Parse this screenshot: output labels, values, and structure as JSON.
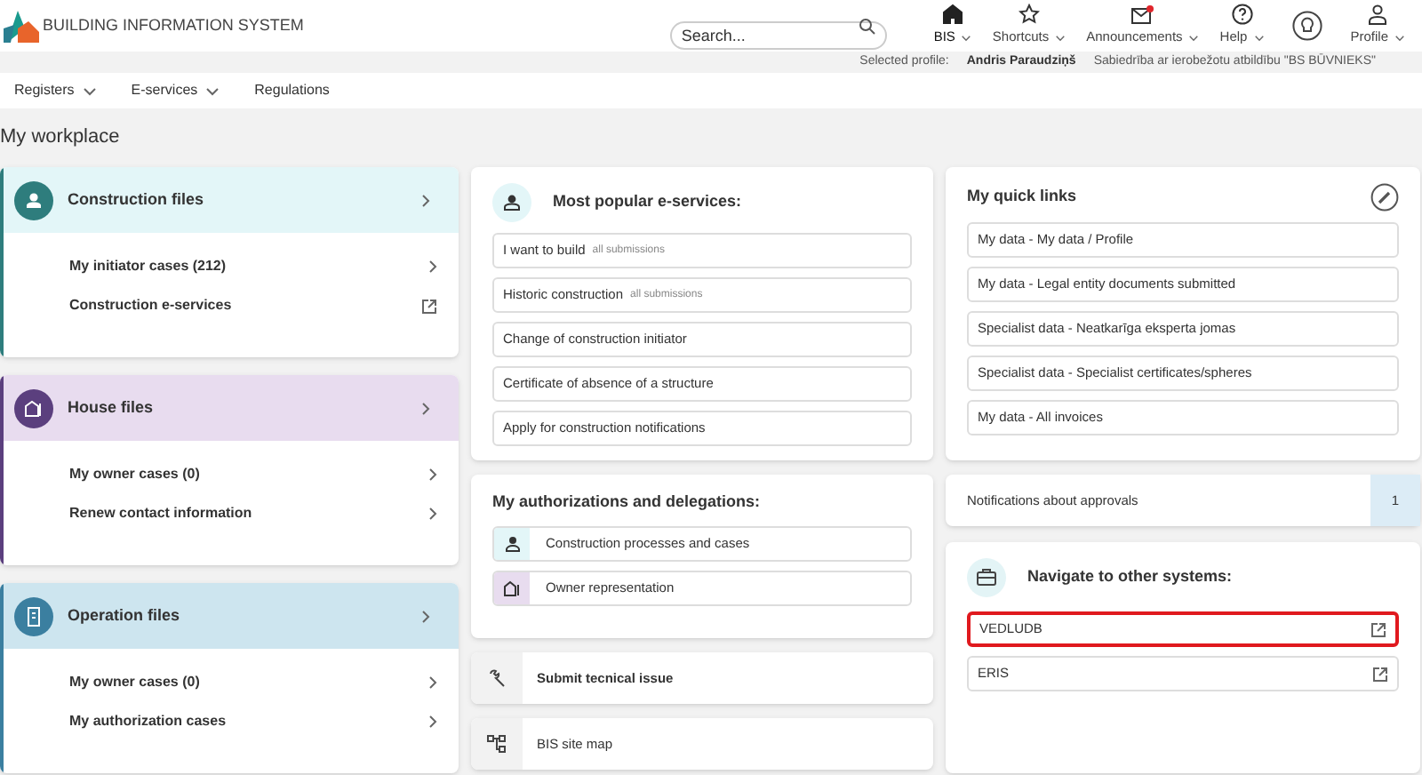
{
  "header": {
    "title": "BUILDING INFORMATION SYSTEM",
    "search": {
      "placeholder": "Search..."
    },
    "nav": [
      {
        "label": "BIS",
        "selected": true,
        "dropdown": true
      },
      {
        "label": "Shortcuts",
        "selected": false,
        "dropdown": true
      },
      {
        "label": "Announcements",
        "selected": false,
        "dropdown": true,
        "unread": true
      },
      {
        "label": "Help",
        "selected": false,
        "dropdown": true
      },
      {
        "label": "Profile",
        "selected": false,
        "dropdown": true
      }
    ]
  },
  "profile_bar": {
    "label": "Selected profile:",
    "name": "Andris Paraudziņš",
    "company": "Sabiedrība ar ierobežotu atbildību \"BS BŪVNIEKS\""
  },
  "menu": [
    {
      "label": "Registers",
      "dropdown": true
    },
    {
      "label": "E-services",
      "dropdown": true
    },
    {
      "label": "Regulations",
      "dropdown": false
    }
  ],
  "page_title": "My workplace",
  "file_cards": [
    {
      "title": "Construction files",
      "color": "#2e7d7d",
      "items": [
        {
          "label": "My initiator cases (212)",
          "kind": "link"
        },
        {
          "label": "Construction e-services",
          "kind": "external"
        }
      ]
    },
    {
      "title": "House files",
      "color": "#5b3f7e",
      "items": [
        {
          "label": "My owner cases (0)",
          "kind": "link"
        },
        {
          "label": "Renew contact information",
          "kind": "link"
        }
      ]
    },
    {
      "title": "Operation files",
      "color": "#3b7fa0",
      "items": [
        {
          "label": "My owner cases (0)",
          "kind": "link"
        },
        {
          "label": "My authorization cases",
          "kind": "link"
        }
      ]
    }
  ],
  "popular": {
    "title": "Most popular e-services:",
    "items": [
      {
        "label": "I want to build",
        "note": "all submissions"
      },
      {
        "label": "Historic construction",
        "note": "all submissions"
      },
      {
        "label": "Change of construction initiator"
      },
      {
        "label": "Certificate of absence of a structure"
      },
      {
        "label": "Apply for construction notifications"
      }
    ]
  },
  "authorizations": {
    "title": "My authorizations and delegations:",
    "items": [
      {
        "label": "Construction processes and cases",
        "color": "#e3f6f8"
      },
      {
        "label": "Owner representation",
        "color": "#e8dcef"
      }
    ]
  },
  "actions": [
    {
      "label": "Submit tecnical issue",
      "bold": true
    },
    {
      "label": "BIS site map",
      "bold": false
    }
  ],
  "quick_links": {
    "title": "My quick links",
    "items": [
      "My data - My data / Profile",
      "My data - Legal entity documents submitted",
      "Specialist data - Neatkarīga eksperta jomas",
      "Specialist data - Specialist certificates/spheres",
      "My data - All invoices"
    ]
  },
  "notifications": {
    "label": "Notifications about approvals",
    "count": "1"
  },
  "other_systems": {
    "title": "Navigate to other systems:",
    "items": [
      {
        "label": "VEDLUDB",
        "highlighted": true
      },
      {
        "label": "ERIS",
        "highlighted": false
      }
    ]
  }
}
